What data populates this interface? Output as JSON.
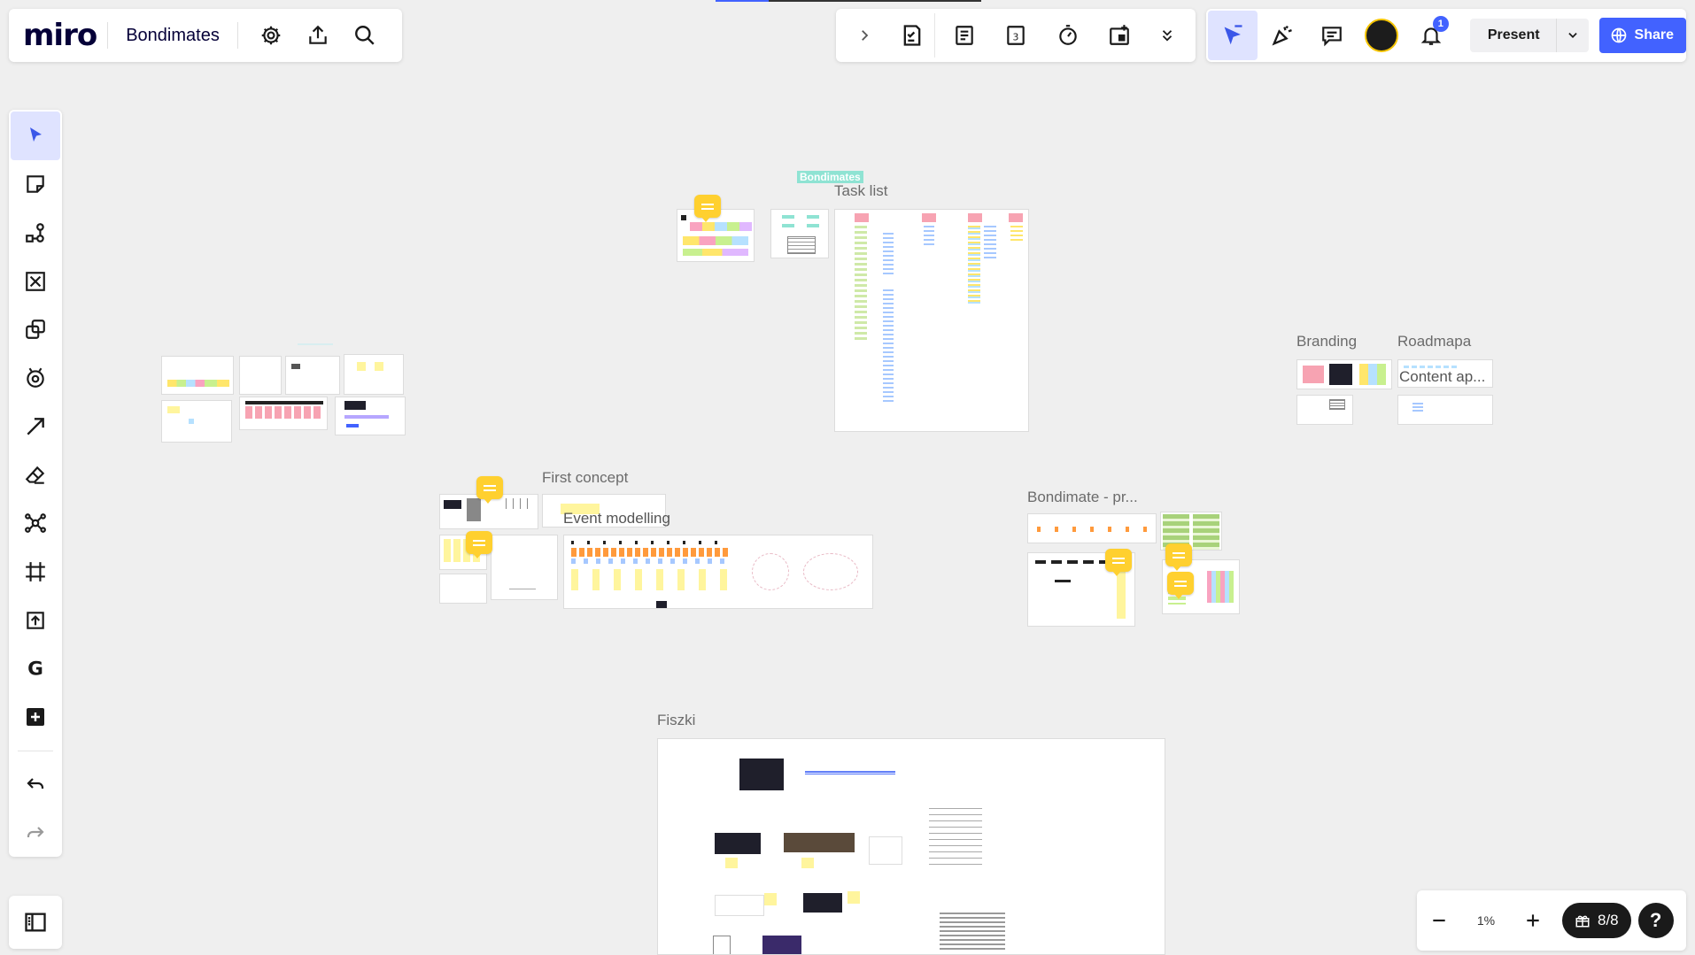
{
  "app": {
    "logo": "miro",
    "board_name": "Bondimates"
  },
  "topbar_left": {
    "icons": [
      "gear-icon",
      "upload-icon",
      "search-icon"
    ]
  },
  "topbar_mid": {
    "icons": [
      "chevron-right-icon",
      "checklist-icon",
      "notes-icon",
      "calendar-icon",
      "timer-icon",
      "card-add-icon",
      "double-chevron-down-icon"
    ]
  },
  "topbar_right": {
    "present_label": "Present",
    "share_label": "Share",
    "notification_count": "1"
  },
  "left_toolbar": {
    "tools": [
      "select",
      "sticky-note",
      "shapes-connector",
      "template",
      "shapes",
      "emoji",
      "arrow",
      "eraser",
      "mind-map",
      "frame",
      "upload",
      "apps-g",
      "add"
    ]
  },
  "bottom": {
    "zoom_level": "1%",
    "frames_count": "8/8"
  },
  "canvas": {
    "titles": {
      "bondimates_tag": "Bondimates",
      "task_list": "Task list",
      "branding": "Branding",
      "roadmapa": "Roadmapa",
      "content_ap": "Content ap...",
      "first_concept": "First concept",
      "event_modelling": "Event modelling",
      "bondimate_pr": "Bondimate - pr...",
      "fiszki": "Fiszki"
    }
  },
  "colors": {
    "accent": "#4262ff",
    "canvas_bg": "#efefef",
    "comment": "#ffd02f",
    "sticky_yellow": "#fff59d",
    "sticky_pink": "#f7a3b2"
  }
}
